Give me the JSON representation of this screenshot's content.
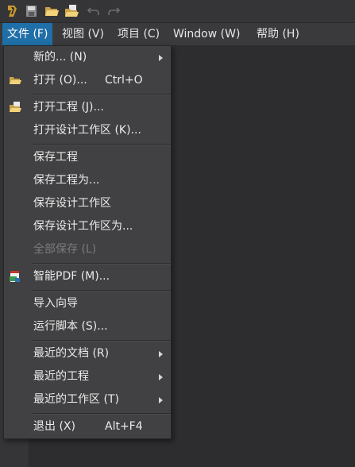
{
  "toolbar": {
    "icons": [
      "app-logo-icon",
      "save-icon",
      "open-folder-icon",
      "open-project-icon",
      "undo-icon",
      "redo-icon"
    ]
  },
  "menubar": {
    "file": "文件 (F)",
    "view": "视图 (V)",
    "project": "项目 (C)",
    "window": "Window (W)",
    "help": "帮助 (H)"
  },
  "file_menu": {
    "new": "新的... (N)",
    "open": "打开 (O)...",
    "open_shortcut": "Ctrl+O",
    "open_project": "打开工程 (J)...",
    "open_workspace": "打开设计工作区 (K)...",
    "save_project": "保存工程",
    "save_project_as": "保存工程为...",
    "save_workspace": "保存设计工作区",
    "save_workspace_as": "保存设计工作区为...",
    "save_all": "全部保存 (L)",
    "smart_pdf": "智能PDF (M)...",
    "import_wizard": "导入向导",
    "run_script": "运行脚本 (S)...",
    "recent_docs": "最近的文档 (R)",
    "recent_projects": "最近的工程",
    "recent_workspaces": "最近的工作区 (T)",
    "exit": "退出 (X)",
    "exit_shortcut": "Alt+F4"
  },
  "colors": {
    "background": "#2d2d2f",
    "menu_bg": "#414143",
    "active_menu": "#1f6fa8",
    "disabled_text": "#7a7a7c"
  }
}
